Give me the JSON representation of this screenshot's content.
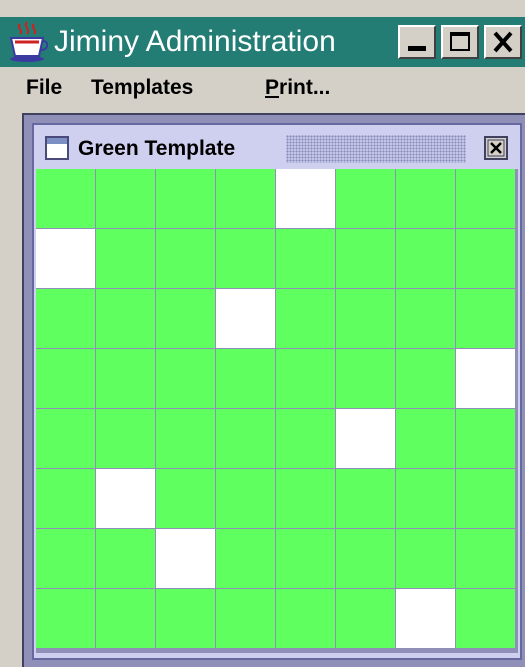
{
  "window": {
    "title": "Jiminy Administration",
    "icon": "java-cup-icon",
    "controls": [
      "minimize",
      "maximize",
      "close"
    ]
  },
  "menu": {
    "file": "File",
    "templates": "Templates",
    "print_first": "P",
    "print_rest": "rint..."
  },
  "internal_frame": {
    "title": "Green Template",
    "icon": "window-icon",
    "close_icon": "close-icon"
  },
  "colors": {
    "titlebar": "#237d75",
    "filled_cell": "#60ff60",
    "empty_cell": "#ffffff",
    "frame_title_bg": "#cfd0ef",
    "desktop": "#8f8fb8"
  },
  "template_grid": {
    "rows": 8,
    "cols": 8,
    "cells": [
      [
        1,
        1,
        1,
        1,
        0,
        1,
        1,
        1
      ],
      [
        0,
        1,
        1,
        1,
        1,
        1,
        1,
        1
      ],
      [
        1,
        1,
        1,
        0,
        1,
        1,
        1,
        1
      ],
      [
        1,
        1,
        1,
        1,
        1,
        1,
        1,
        0
      ],
      [
        1,
        1,
        1,
        1,
        1,
        0,
        1,
        1
      ],
      [
        1,
        0,
        1,
        1,
        1,
        1,
        1,
        1
      ],
      [
        1,
        1,
        0,
        1,
        1,
        1,
        1,
        1
      ],
      [
        1,
        1,
        1,
        1,
        1,
        1,
        0,
        1
      ]
    ]
  }
}
